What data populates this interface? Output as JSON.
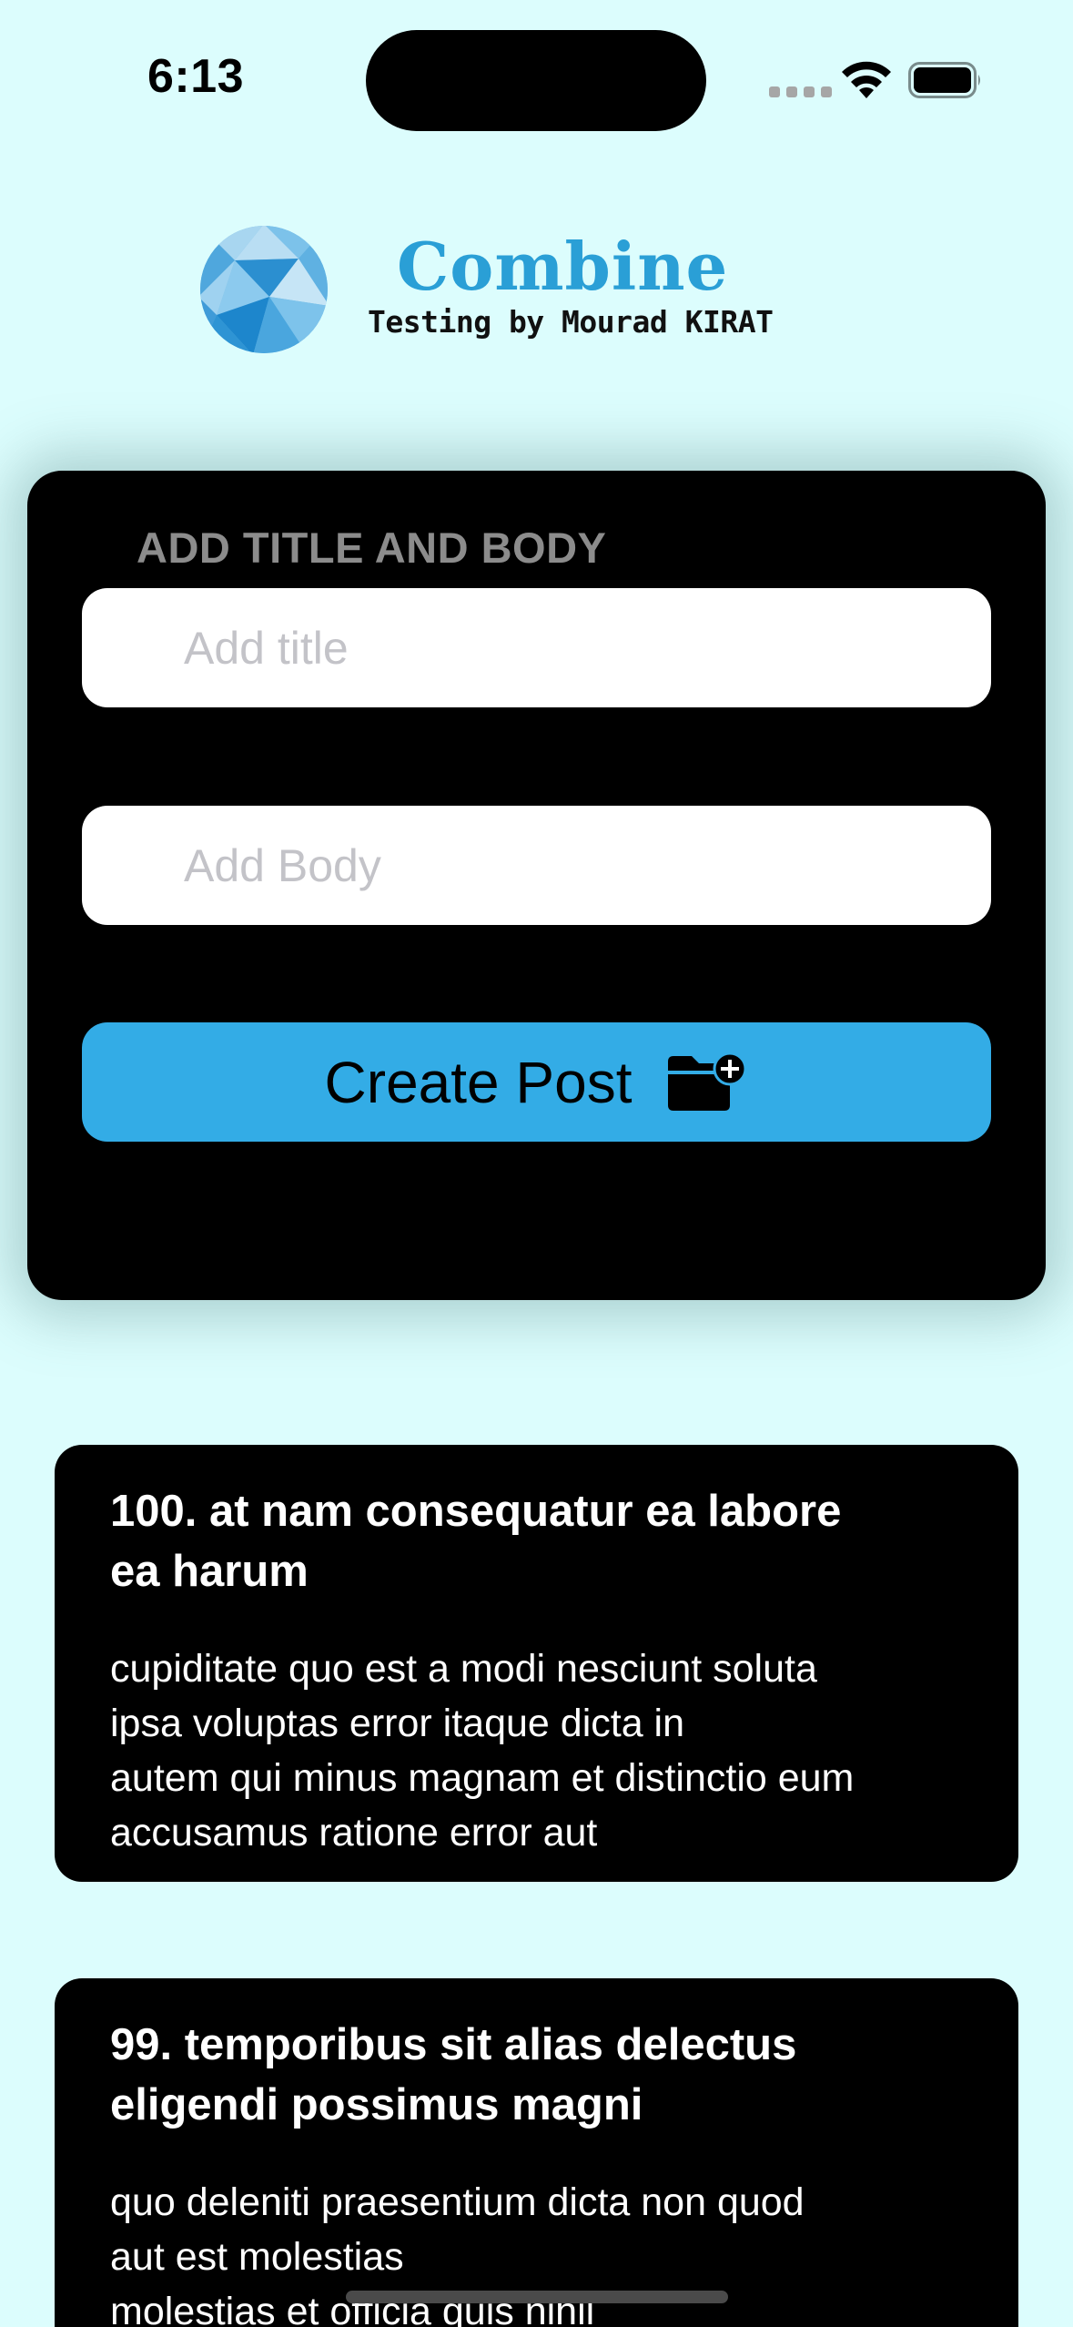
{
  "status_bar": {
    "time": "6:13",
    "signal_icon": "signal-dots-icon",
    "wifi_icon": "wifi-icon",
    "battery_icon": "battery-icon"
  },
  "header": {
    "logo_icon": "globe-polygon-icon",
    "title": "Combine",
    "subtitle": "Testing by Mourad KIRAT",
    "title_color": "#2a9fd6"
  },
  "form": {
    "heading": "ADD TITLE AND BODY",
    "title_placeholder": "Add title",
    "title_value": "",
    "body_placeholder": "Add Body",
    "body_value": "",
    "create_button_label": "Create Post",
    "create_button_icon": "folder-add-icon",
    "button_color": "#33ace6"
  },
  "posts": [
    {
      "title": "100. at nam consequatur ea labore ea harum",
      "body": "cupiditate quo est a modi nesciunt soluta\nipsa voluptas error itaque dicta in\nautem qui minus magnam et distinctio eum\naccusamus ratione error aut"
    },
    {
      "title": "99. temporibus sit alias delectus eligendi possimus magni",
      "body": "quo deleniti praesentium dicta non quod\naut est molestias\nmolestias et officia quis nihil"
    }
  ]
}
